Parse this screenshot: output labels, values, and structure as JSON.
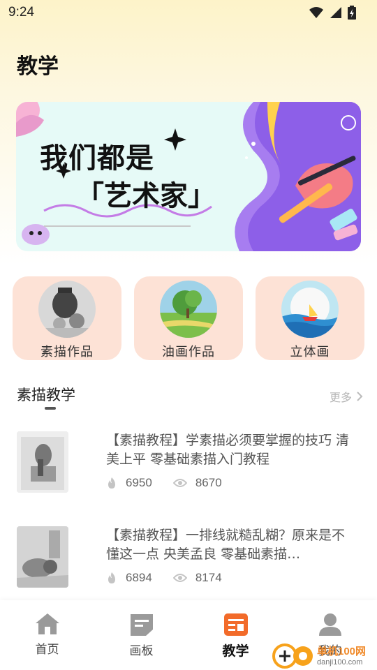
{
  "status_bar": {
    "time": "9:24"
  },
  "page": {
    "title": "教学"
  },
  "banner": {
    "line1": "我们都是",
    "line2": "「艺术家」"
  },
  "categories": [
    {
      "label": "素描作品"
    },
    {
      "label": "油画作品"
    },
    {
      "label": "立体画"
    }
  ],
  "section": {
    "title": "素描教学",
    "more": "更多"
  },
  "articles": [
    {
      "title": "【素描教程】学素描必须要掌握的技巧 清美上平 零基础素描入门教程",
      "likes": "6950",
      "views": "8670"
    },
    {
      "title": "【素描教程】一排线就糙乱糊？原来是不懂这一点 央美孟良 零基础素描…",
      "likes": "6894",
      "views": "8174"
    }
  ],
  "nav": [
    {
      "label": "首页",
      "icon": "home-icon"
    },
    {
      "label": "画板",
      "icon": "board-icon"
    },
    {
      "label": "教学",
      "icon": "teaching-icon",
      "active": true
    },
    {
      "label": "我的",
      "icon": "profile-icon"
    }
  ],
  "watermark": {
    "brand": "danji100.com",
    "name": "单机100网"
  },
  "colors": {
    "accent": "#f26b2a",
    "card_bg": "#fde2d6",
    "header_bg": "#fdf3c9"
  }
}
